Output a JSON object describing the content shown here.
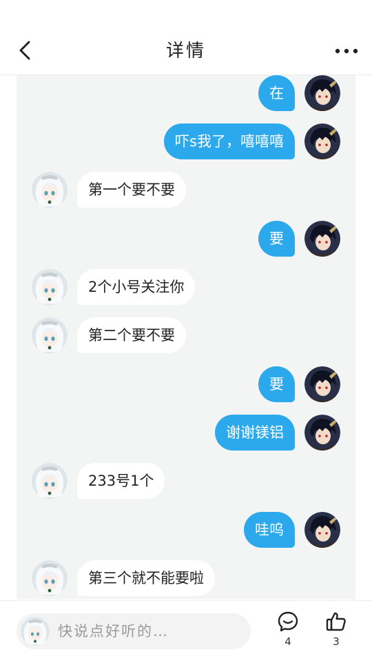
{
  "header": {
    "title": "详情",
    "back_icon": "chevron-left-icon",
    "more_icon": "more-dots-icon"
  },
  "colors": {
    "sent_bubble": "#2ba9ec",
    "received_bubble": "#ffffff",
    "chat_background": "#f3f5f4"
  },
  "messages": [
    {
      "sender": "me",
      "text": "在"
    },
    {
      "sender": "me",
      "text": "吓s我了，嘻嘻嘻"
    },
    {
      "sender": "them",
      "text": "第一个要不要"
    },
    {
      "sender": "me",
      "text": "要"
    },
    {
      "sender": "them",
      "text": "2个小号关注你"
    },
    {
      "sender": "them",
      "text": "第二个要不要"
    },
    {
      "sender": "me",
      "text": "要"
    },
    {
      "sender": "me",
      "text": "谢谢镁铝"
    },
    {
      "sender": "them",
      "text": "233号1个"
    },
    {
      "sender": "me",
      "text": "哇呜"
    },
    {
      "sender": "them",
      "text": "第三个就不能要啦"
    }
  ],
  "footer": {
    "placeholder": "快说点好听的…",
    "comment_icon": "comment-bubble-icon",
    "comment_count": "4",
    "like_icon": "thumbs-up-icon",
    "like_count": "3"
  }
}
